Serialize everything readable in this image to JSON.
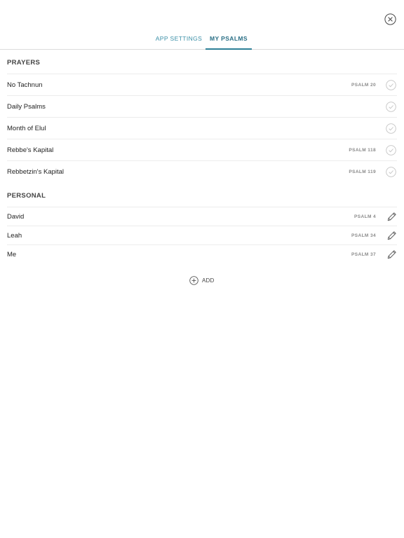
{
  "header": {
    "close_icon": "close-circle-icon"
  },
  "tabs": [
    {
      "label": "APP SETTINGS",
      "active": false
    },
    {
      "label": "MY PSALMS",
      "active": true
    }
  ],
  "colors": {
    "accent": "#2d7f97",
    "tab_inactive": "#3a8fa7",
    "divider": "#ececec",
    "icon_gray": "#b8b8b8"
  },
  "prayers": {
    "title": "PRAYERS",
    "items": [
      {
        "label": "No Tachnun",
        "psalm": "PSALM 20",
        "icon": "check-circle-icon"
      },
      {
        "label": "Daily Psalms",
        "psalm": "",
        "icon": "check-circle-icon"
      },
      {
        "label": "Month of Elul",
        "psalm": "",
        "icon": "check-circle-icon"
      },
      {
        "label": "Rebbe's Kapital",
        "psalm": "PSALM 118",
        "icon": "check-circle-icon"
      },
      {
        "label": "Rebbetzin's Kapital",
        "psalm": "PSALM 119",
        "icon": "check-circle-icon"
      }
    ]
  },
  "personal": {
    "title": "PERSONAL",
    "items": [
      {
        "label": "David",
        "psalm": "PSALM 4",
        "icon": "pencil-icon"
      },
      {
        "label": "Leah",
        "psalm": "PSALM 34",
        "icon": "pencil-icon"
      },
      {
        "label": "Me",
        "psalm": "PSALM 37",
        "icon": "pencil-icon"
      }
    ]
  },
  "add": {
    "label": "ADD",
    "icon": "plus-circle-icon"
  }
}
